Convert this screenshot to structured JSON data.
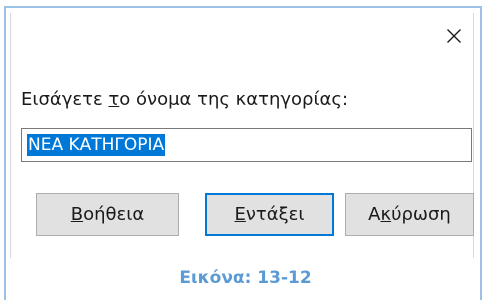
{
  "dialog": {
    "close_glyph": "✕",
    "close_icon": "close-icon",
    "prompt": {
      "before": "Εισάγετε ",
      "mnemonic": "τ",
      "after": "ο όνομα της κατηγορίας:"
    },
    "input_value": "ΝΕΑ ΚΑΤΗΓΟΡΙΑ",
    "buttons": {
      "help": {
        "mnemonic": "Β",
        "rest": "οήθεια"
      },
      "ok": {
        "mnemonic": "Ε",
        "rest": "ντάξει"
      },
      "cancel": {
        "before": "Α",
        "mnemonic": "κ",
        "after": "ύρωση"
      }
    }
  },
  "caption": "Εικόνα: 13-12",
  "colors": {
    "accent": "#0078d7",
    "caption": "#5b9bd5",
    "frame": "#9bc2e6"
  }
}
